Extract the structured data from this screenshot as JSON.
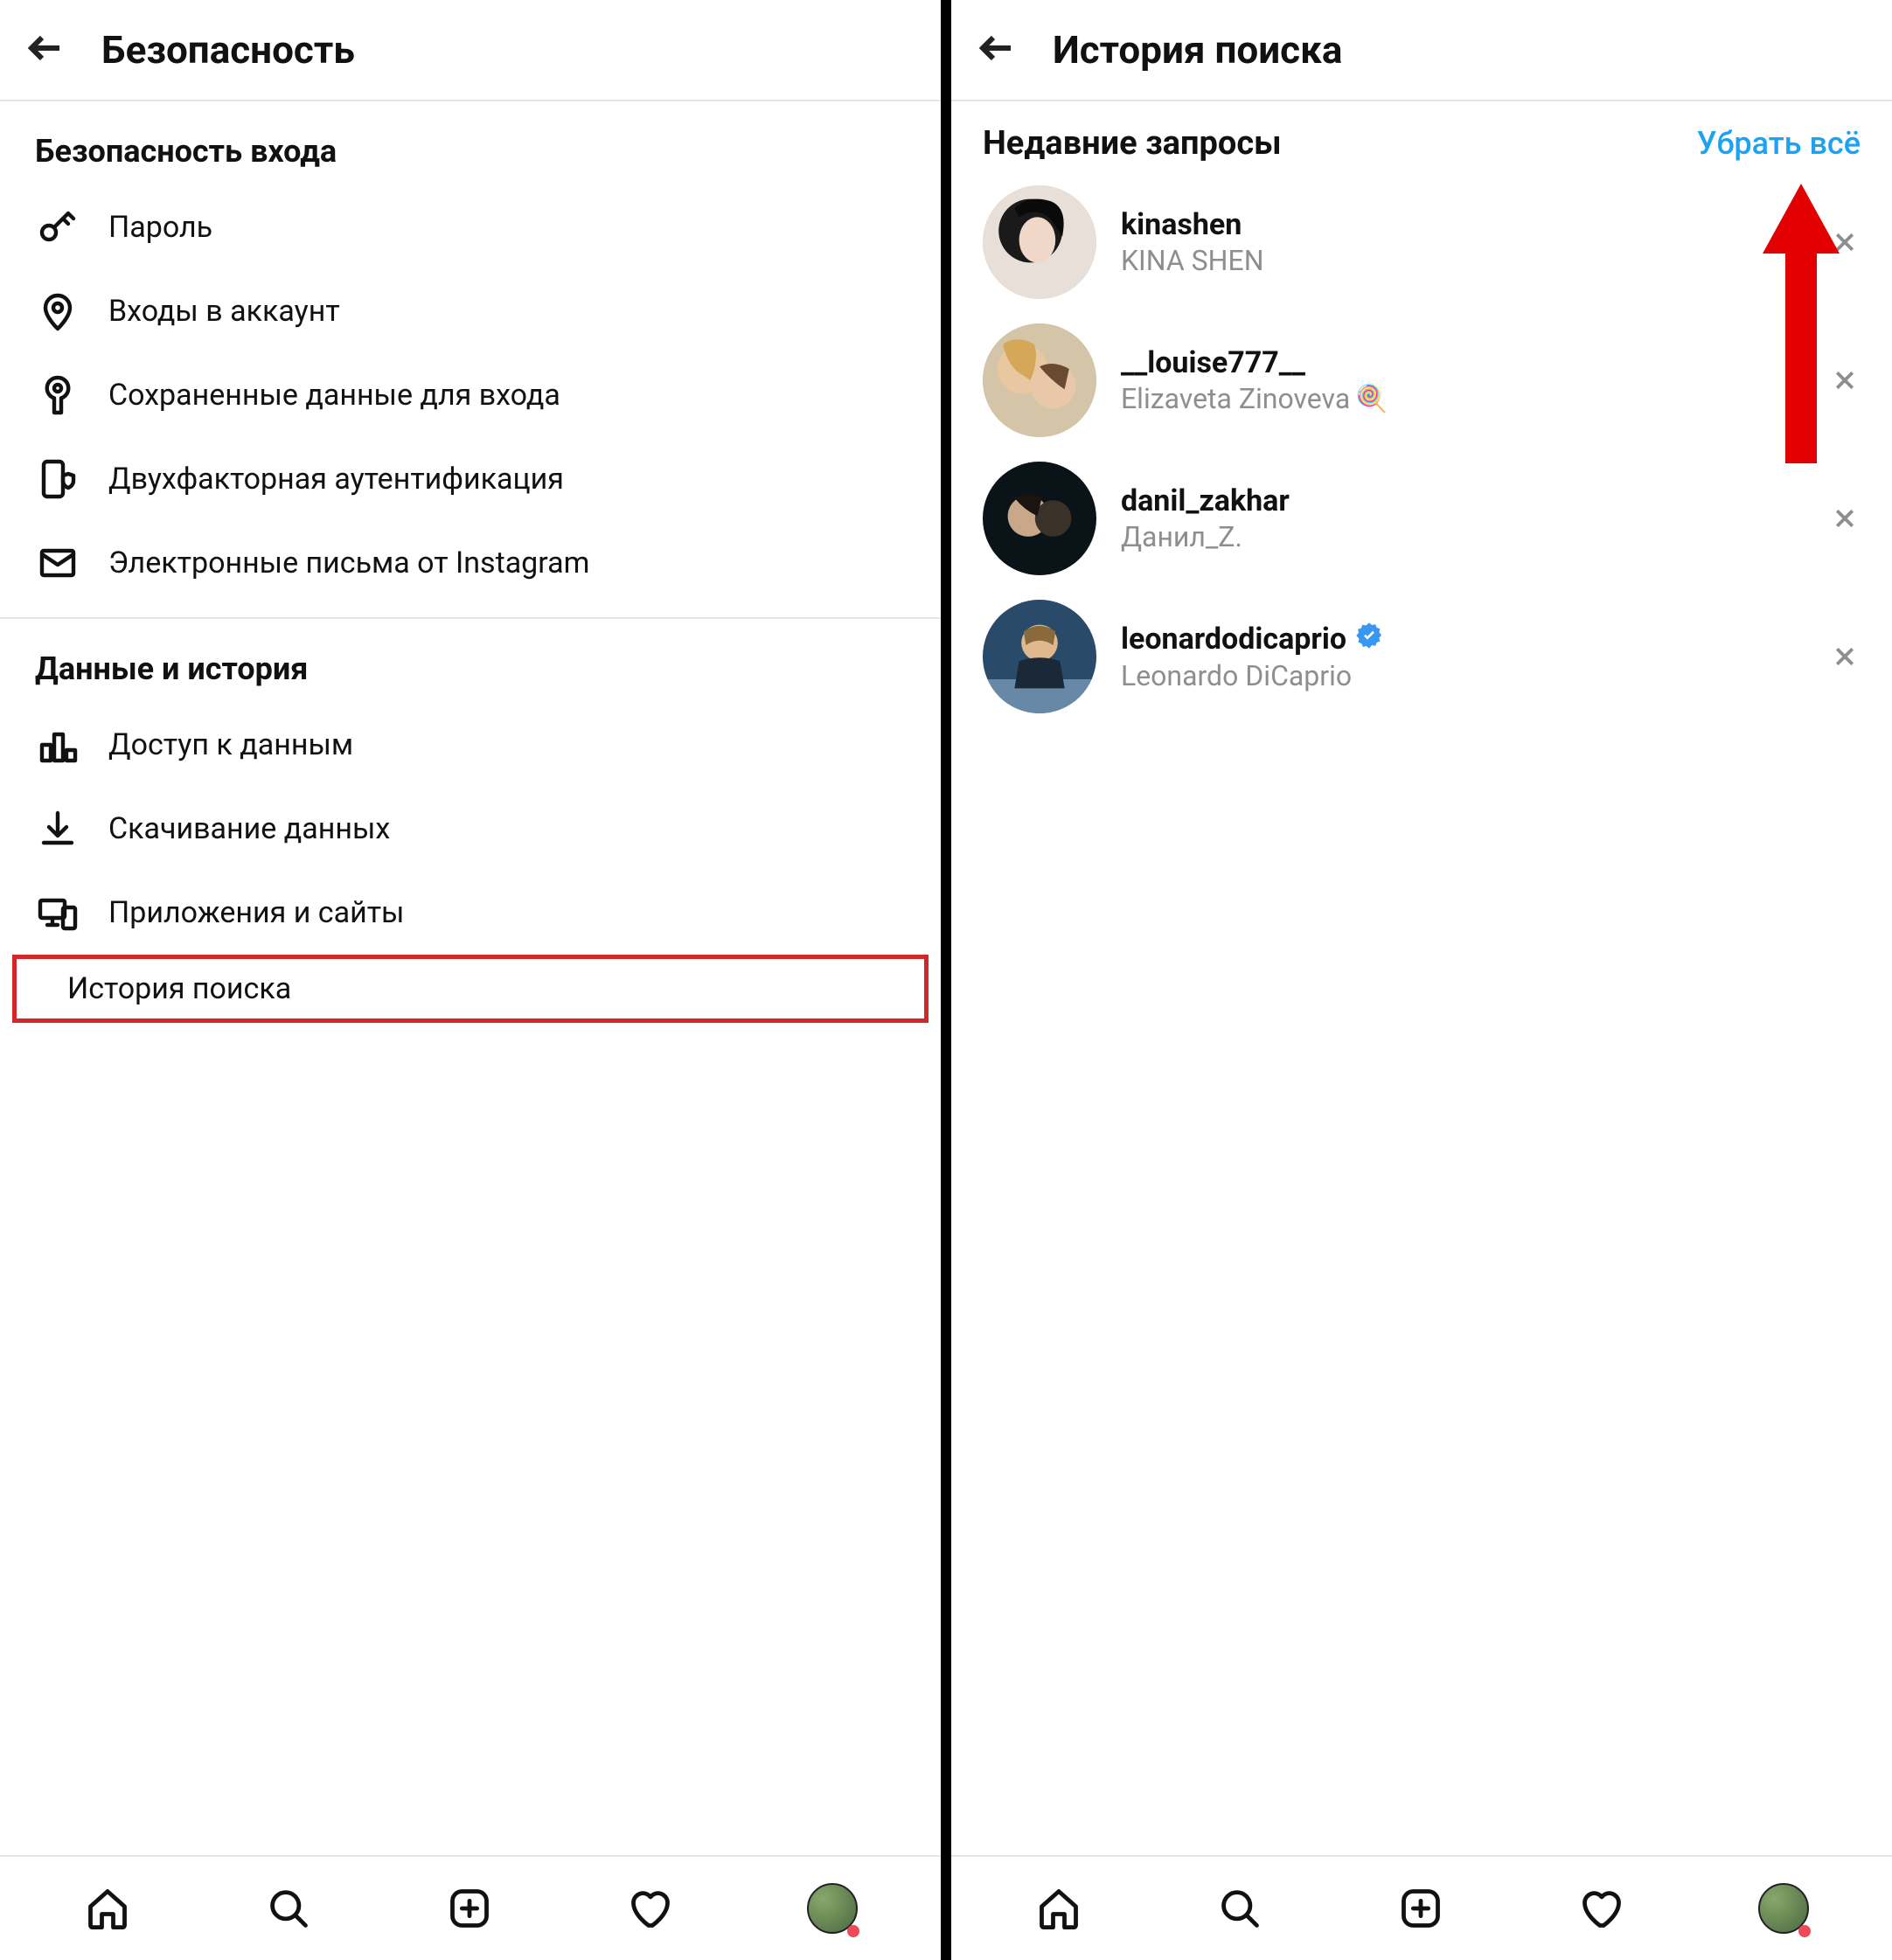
{
  "left": {
    "header_title": "Безопасность",
    "section1_title": "Безопасность входа",
    "items1": [
      {
        "icon": "key-icon",
        "label": "Пароль"
      },
      {
        "icon": "location-pin-icon",
        "label": "Входы в аккаунт"
      },
      {
        "icon": "keyhole-icon",
        "label": "Сохраненные данные для входа"
      },
      {
        "icon": "phone-shield-icon",
        "label": "Двухфакторная аутентификация"
      },
      {
        "icon": "mail-icon",
        "label": "Электронные письма от Instagram"
      }
    ],
    "section2_title": "Данные и история",
    "items2": [
      {
        "icon": "bar-chart-icon",
        "label": "Доступ к данным"
      },
      {
        "icon": "download-icon",
        "label": "Скачивание данных"
      },
      {
        "icon": "devices-icon",
        "label": "Приложения и сайты"
      }
    ],
    "highlighted_item": {
      "icon": "search-icon",
      "label": "История поиска"
    }
  },
  "right": {
    "header_title": "История поиска",
    "recent_label": "Недавние запросы",
    "clear_label": "Убрать всё",
    "results": [
      {
        "username": "kinashen",
        "fullname": "KINA SHEN",
        "verified": false,
        "emoji": ""
      },
      {
        "username": "__louise777__",
        "fullname": "Elizaveta Zinoveva",
        "verified": false,
        "emoji": "🍭"
      },
      {
        "username": "danil_zakhar",
        "fullname": "Данил_Z.",
        "verified": false,
        "emoji": ""
      },
      {
        "username": "leonardodicaprio",
        "fullname": "Leonardo DiCaprio",
        "verified": true,
        "emoji": ""
      }
    ]
  },
  "nav": {
    "items": [
      "home-icon",
      "search-icon",
      "add-post-icon",
      "heart-icon",
      "profile-avatar"
    ]
  },
  "colors": {
    "accent_blue": "#1da1f2",
    "annotation_red": "#e30000",
    "text_secondary": "#8e8e8e"
  }
}
